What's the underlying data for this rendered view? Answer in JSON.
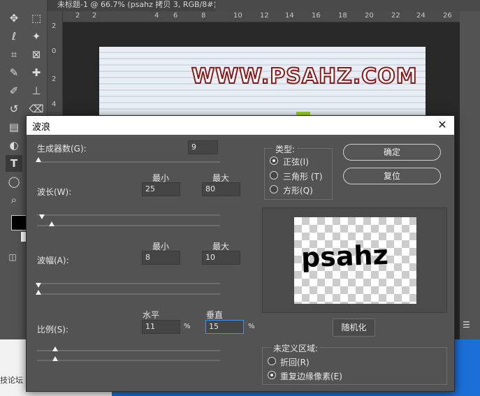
{
  "photoshop": {
    "doc_tab": "未标题-1 @ 66.7% (psahz 拷贝 3, RGB/8#)",
    "ruler_top": [
      "2",
      "2",
      "4",
      "6",
      "8",
      "10",
      "12",
      "14",
      "16",
      "18",
      "20",
      "22",
      "24",
      "26"
    ],
    "ruler_left": [
      "2",
      "0",
      "2",
      "4"
    ],
    "watermark": "WWW.PSAHZ.COM",
    "bottom_text": "技论坛"
  },
  "dialog": {
    "title": "波浪",
    "generators": {
      "label": "生成器数(G):",
      "value": "9",
      "slider_fraction": 0.0
    },
    "wavelength": {
      "label": "波长(W):",
      "min_header": "最小",
      "max_header": "最大",
      "min": "25",
      "max": "80"
    },
    "amplitude": {
      "label": "波幅(A):",
      "min_header": "最小",
      "max_header": "最大",
      "min": "8",
      "max": "10"
    },
    "scale": {
      "label": "比例(S):",
      "h_header": "水平",
      "v_header": "垂直",
      "h": "11",
      "v": "15",
      "unit": "%"
    },
    "type_group": {
      "title": "类型:",
      "options": [
        "正弦(I)",
        "三角形 (T)",
        "方形(Q)"
      ],
      "selected": "正弦(I)"
    },
    "ok_label": "确定",
    "reset_label": "复位",
    "randomize_label": "随机化",
    "preview_text": "psahz",
    "undefined_group": {
      "title": "未定义区域:",
      "options": [
        "折回(R)",
        "重复边缘像素(E)"
      ],
      "selected": "重复边缘像素(E)"
    }
  }
}
